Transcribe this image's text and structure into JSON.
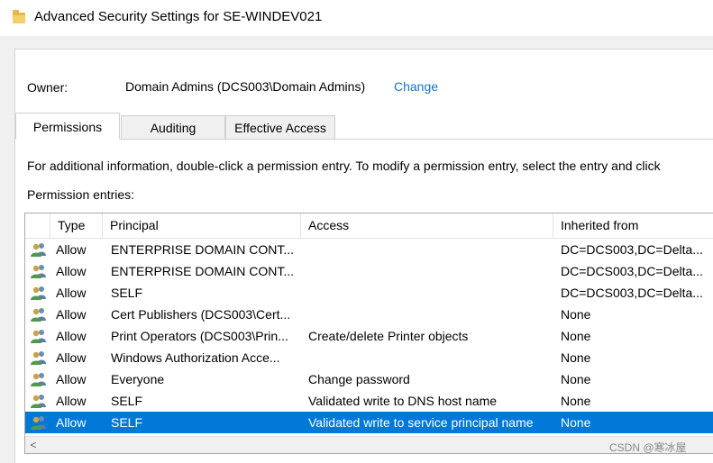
{
  "window": {
    "title": "Advanced Security Settings for SE-WINDEV021"
  },
  "owner": {
    "label": "Owner:",
    "value": "Domain Admins (DCS003\\Domain Admins)",
    "change_link": "Change"
  },
  "tabs": [
    {
      "label": "Permissions",
      "active": true
    },
    {
      "label": "Auditing",
      "active": false
    },
    {
      "label": "Effective Access",
      "active": false
    }
  ],
  "info_text": "For additional information, double-click a permission entry. To modify a permission entry, select the entry and click",
  "entries_label": "Permission entries:",
  "table": {
    "columns": [
      "Type",
      "Principal",
      "Access",
      "Inherited from"
    ],
    "rows": [
      {
        "type": "Allow",
        "principal": "ENTERPRISE DOMAIN CONT...",
        "access": "",
        "inherited": "DC=DCS003,DC=Delta..."
      },
      {
        "type": "Allow",
        "principal": "ENTERPRISE DOMAIN CONT...",
        "access": "",
        "inherited": "DC=DCS003,DC=Delta..."
      },
      {
        "type": "Allow",
        "principal": "SELF",
        "access": "",
        "inherited": "DC=DCS003,DC=Delta..."
      },
      {
        "type": "Allow",
        "principal": "Cert Publishers (DCS003\\Cert...",
        "access": "",
        "inherited": "None"
      },
      {
        "type": "Allow",
        "principal": "Print Operators (DCS003\\Prin...",
        "access": "Create/delete Printer objects",
        "inherited": "None"
      },
      {
        "type": "Allow",
        "principal": "Windows Authorization Acce...",
        "access": "",
        "inherited": "None"
      },
      {
        "type": "Allow",
        "principal": "Everyone",
        "access": "Change password",
        "inherited": "None"
      },
      {
        "type": "Allow",
        "principal": "SELF",
        "access": "Validated write to DNS host name",
        "inherited": "None"
      },
      {
        "type": "Allow",
        "principal": "SELF",
        "access": "Validated write to service principal name",
        "inherited": "None",
        "selected": true
      }
    ]
  },
  "scrollbar": {
    "left_arrow": "<"
  },
  "watermark": "CSDN @寒冰屋",
  "icons": {
    "window": "folder-icon",
    "entry": "user-group-icon"
  },
  "colors": {
    "selection": "#0078d7",
    "link": "#1a73c9"
  }
}
